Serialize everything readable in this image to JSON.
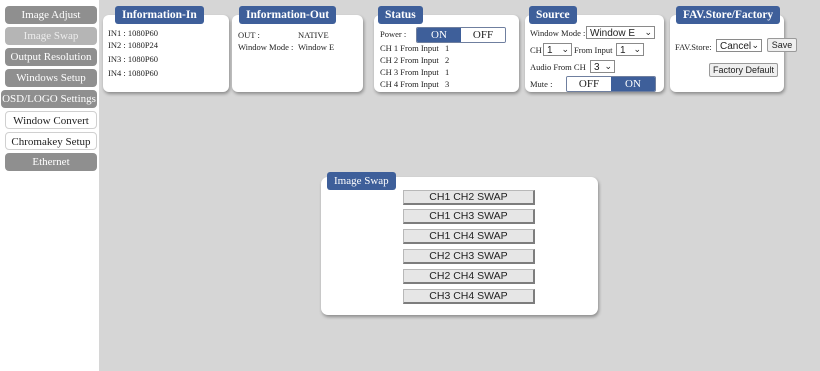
{
  "sidebar": {
    "items": [
      {
        "label": "Image Adjust"
      },
      {
        "label": "Image Swap"
      },
      {
        "label": "Output Resolution"
      },
      {
        "label": "Windows Setup"
      },
      {
        "label": "OSD/LOGO Settings"
      },
      {
        "label": "Window Convert"
      },
      {
        "label": "Chromakey Setup"
      },
      {
        "label": "Ethernet"
      }
    ]
  },
  "info_in": {
    "title": "Information-In",
    "lines": [
      "IN1 : 1080P60",
      "IN2 : 1080P24",
      "IN3 : 1080P60",
      "IN4 : 1080P60"
    ]
  },
  "info_out": {
    "title": "Information-Out",
    "out_label": "OUT :",
    "out_value": "NATIVE",
    "window_mode_label": "Window Mode :",
    "window_mode_value": "Window E"
  },
  "status": {
    "title": "Status",
    "power_label": "Power :",
    "power_on": "ON",
    "power_off": "OFF",
    "channels": [
      {
        "label": "CH 1 From Input",
        "value": "1"
      },
      {
        "label": "CH 2 From Input",
        "value": "2"
      },
      {
        "label": "CH 3 From Input",
        "value": "1"
      },
      {
        "label": "CH 4 From Input",
        "value": "3"
      }
    ]
  },
  "source": {
    "title": "Source",
    "window_mode_label": "Window Mode :",
    "window_mode_value": "Window E",
    "ch_label": "CH",
    "ch_value": "1",
    "from_input_label": "From Input",
    "from_input_value": "1",
    "audio_label": "Audio From CH",
    "audio_value": "3",
    "mute_label": "Mute :",
    "mute_off": "OFF",
    "mute_on": "ON"
  },
  "fav": {
    "title": "FAV.Store/Factory",
    "store_label": "FAV.Store:",
    "store_value": "Cancel",
    "save_label": "Save",
    "factory_label": "Factory Default"
  },
  "image_swap": {
    "title": "Image Swap",
    "buttons": [
      "CH1 CH2 SWAP",
      "CH1 CH3 SWAP",
      "CH1 CH4 SWAP",
      "CH2 CH3 SWAP",
      "CH2 CH4 SWAP",
      "CH3 CH4 SWAP"
    ]
  },
  "colors": {
    "accent": "#3e5f9a",
    "sidebar_dark": "#8f8f8f",
    "sidebar_active": "#b5b5b5",
    "background": "#d6d6d6"
  }
}
